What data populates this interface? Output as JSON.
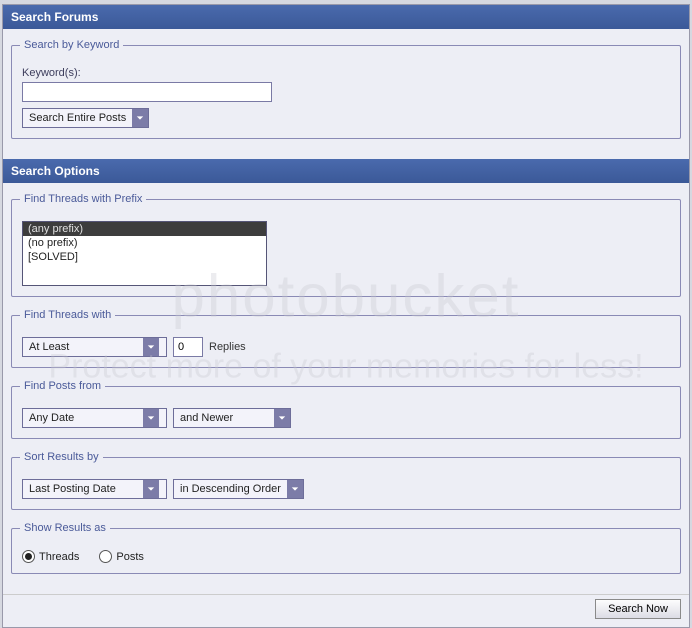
{
  "header1": "Search Forums",
  "header2": "Search Options",
  "keyword": {
    "legend": "Search by Keyword",
    "label": "Keyword(s):",
    "value": "",
    "scope_selected": "Search Entire Posts"
  },
  "prefix": {
    "legend": "Find Threads with Prefix",
    "items": [
      "(any prefix)",
      "(no prefix)",
      "[SOLVED]"
    ],
    "selected_index": 0
  },
  "replies": {
    "legend": "Find Threads with",
    "mode_selected": "At Least",
    "count": "0",
    "suffix": "Replies"
  },
  "posts_from": {
    "legend": "Find Posts from",
    "date_selected": "Any Date",
    "direction_selected": "and Newer"
  },
  "sort": {
    "legend": "Sort Results by",
    "field_selected": "Last Posting Date",
    "order_selected": "in Descending Order"
  },
  "show_as": {
    "legend": "Show Results as",
    "threads_label": "Threads",
    "posts_label": "Posts",
    "selected": "threads"
  },
  "search_button": "Search Now",
  "watermark": {
    "logo": "photobucket",
    "tagline": "Protect more of your memories for less!"
  }
}
